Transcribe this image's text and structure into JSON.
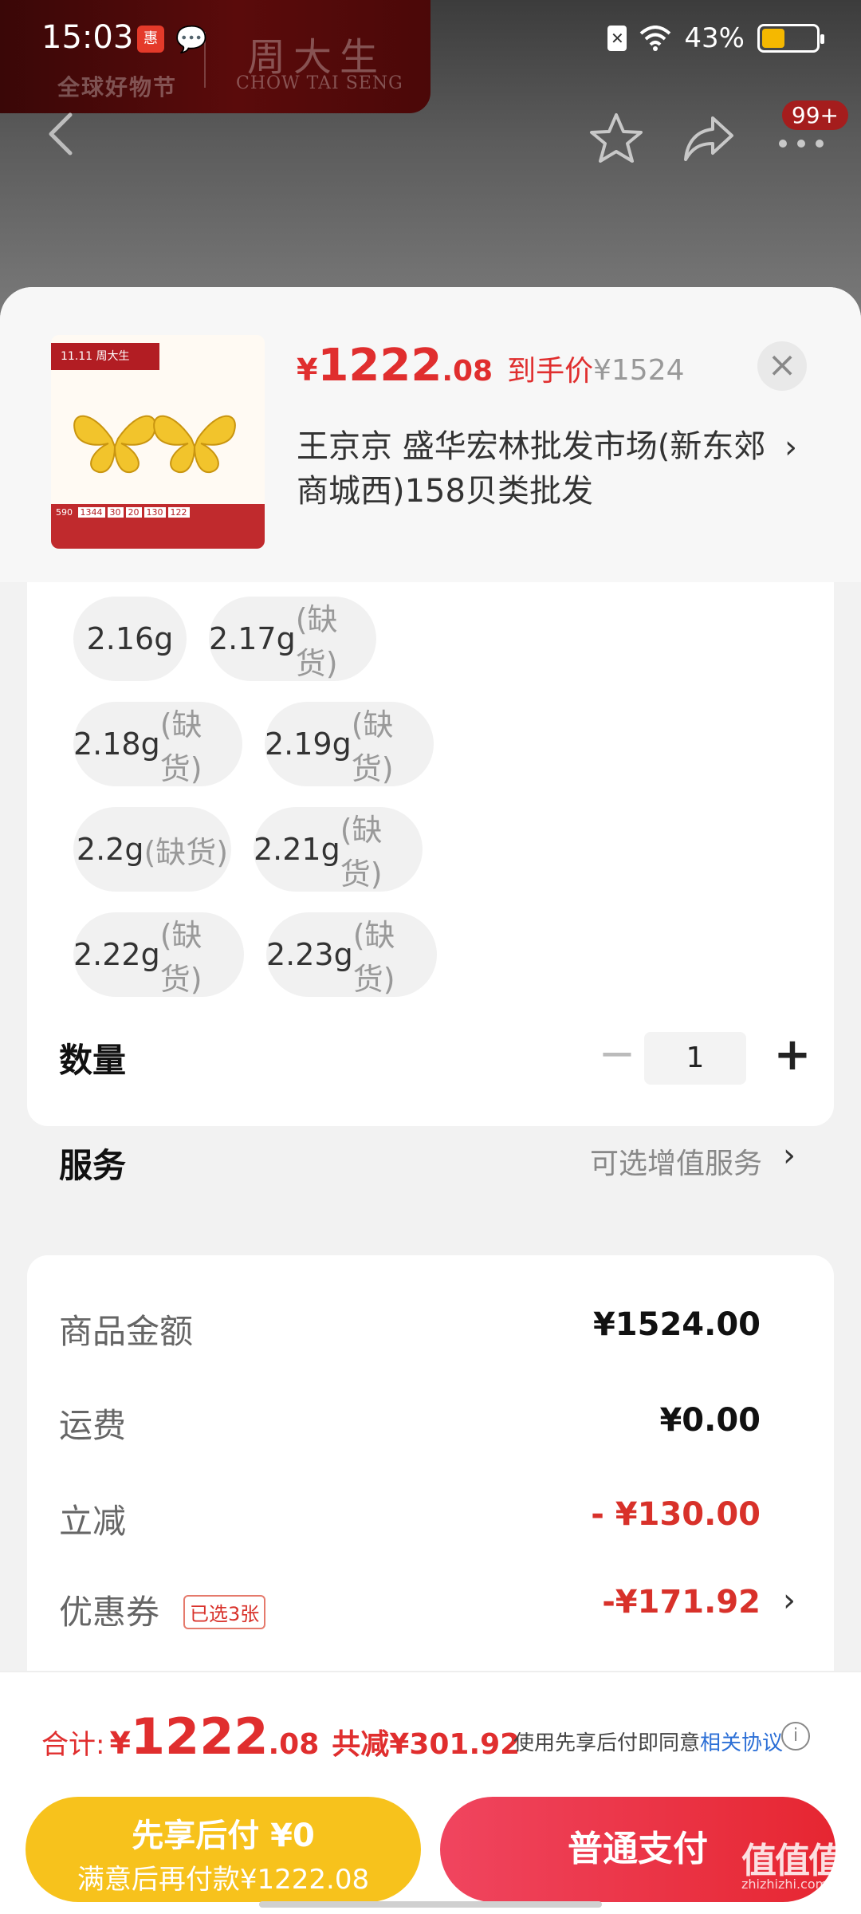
{
  "status_bar": {
    "time": "15:03",
    "battery": "43%",
    "battery_level": 0.43
  },
  "banner": {
    "festival": "全球好物节",
    "brand_cn": "周大生",
    "brand_en": "CHOW TAI SENG",
    "badge": "99+"
  },
  "product": {
    "thumb_tag": "11.11 周大生",
    "price_yen": "¥",
    "price_int": "1222",
    "price_dec": ".08",
    "price_label": "到手价",
    "original_price": "¥1524",
    "shop_name": "王京京  盛华宏林批发市场(新东郊商城西)158贝类批发"
  },
  "specs": [
    {
      "weight": "2.16g",
      "status": ""
    },
    {
      "weight": "2.17g",
      "status": "(缺货)"
    },
    {
      "weight": "2.18g",
      "status": "(缺货)"
    },
    {
      "weight": "2.19g",
      "status": "(缺货)"
    },
    {
      "weight": "2.2g",
      "status": "(缺货)"
    },
    {
      "weight": "2.21g",
      "status": "(缺货)"
    },
    {
      "weight": "2.22g",
      "status": "(缺货)"
    },
    {
      "weight": "2.23g",
      "status": "(缺货)"
    }
  ],
  "quantity": {
    "label": "数量",
    "value": "1",
    "minus": "−",
    "plus": "+"
  },
  "service": {
    "label": "服务",
    "value": "可选增值服务"
  },
  "summary": {
    "goods_label": "商品金额",
    "goods_value": "¥1524.00",
    "shipping_label": "运费",
    "shipping_value": "¥0.00",
    "discount_label": "立减",
    "discount_value": "- ¥130.00",
    "coupon_label": "优惠券",
    "coupon_tag": "已选3张",
    "coupon_value": "-¥171.92"
  },
  "bottom": {
    "total_label": "合计:",
    "total_yen": "¥",
    "total_int": "1222",
    "total_dec": ".08",
    "reduce": "共减¥301.92",
    "agree_text": "使用先享后付即同意",
    "agree_link": "相关协议",
    "pay_later_l1": "先享后付 ¥0",
    "pay_later_l2": "满意后再付款¥1222.08",
    "pay_normal": "普通支付",
    "watermark": "值值值",
    "watermark_sub": "zhizhizhi.com"
  }
}
